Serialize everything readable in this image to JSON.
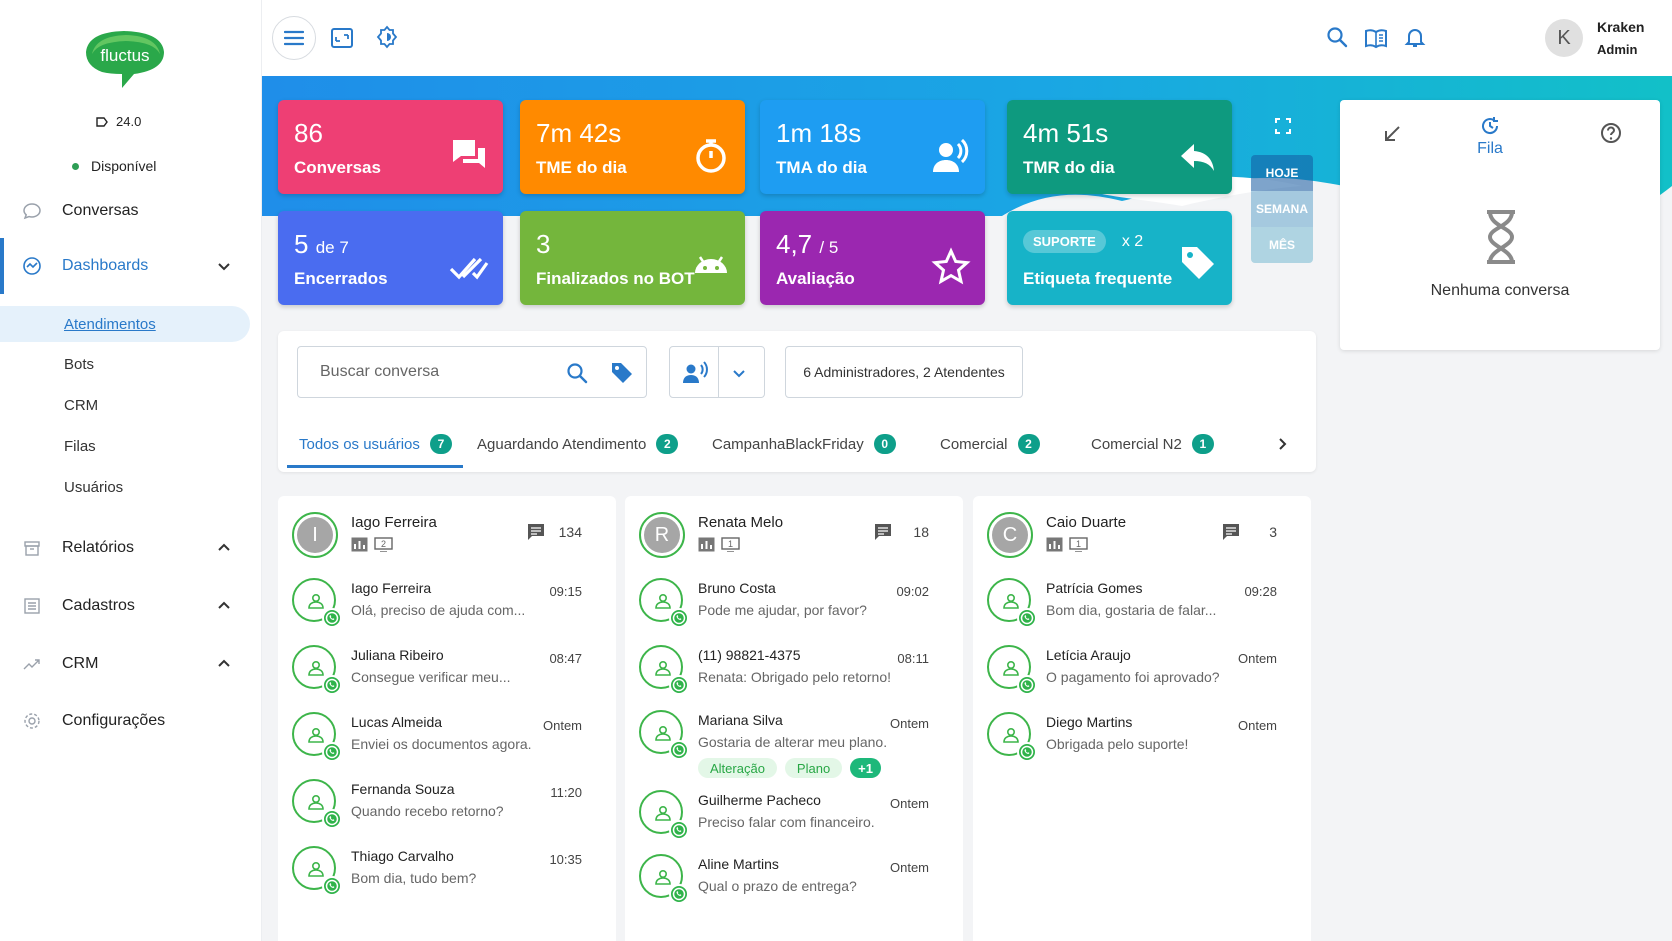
{
  "brand": {
    "logo_text": "fluctus",
    "version": "24.0",
    "status": "Disponível",
    "status_color": "#2e9e55"
  },
  "sidebar": {
    "items": [
      {
        "label": "Conversas",
        "icon": "chat-bubble-icon"
      },
      {
        "label": "Dashboards",
        "icon": "dashboard-gauge-icon"
      },
      {
        "label": "Relatórios",
        "icon": "archive-box-icon"
      },
      {
        "label": "Cadastros",
        "icon": "list-icon"
      },
      {
        "label": "CRM",
        "icon": "trend-chart-icon"
      },
      {
        "label": "Configurações",
        "icon": "gear-icon"
      }
    ],
    "dashboard_sub": [
      "Atendimentos",
      "Bots",
      "CRM",
      "Filas",
      "Usuários"
    ]
  },
  "topbar": {
    "user_initial": "K",
    "user_name": "Kraken",
    "user_role": "Admin"
  },
  "stats": {
    "conversas": {
      "value": "86",
      "label": "Conversas",
      "color": "#ee3f74"
    },
    "tme": {
      "value": "7m 42s",
      "label": "TME do dia",
      "color": "#ff8a00"
    },
    "tma": {
      "value": "1m 18s",
      "label": "TMA do dia",
      "color": "#1e9df2"
    },
    "tmr": {
      "value": "4m 51s",
      "label": "TMR do dia",
      "color": "#0e9a7f"
    },
    "encerrados": {
      "value": "5",
      "of": "de 7",
      "label": "Encerrados",
      "color": "#4a6cf0"
    },
    "bot": {
      "value": "3",
      "label": "Finalizados no BOT",
      "color": "#74b63c"
    },
    "avaliacao": {
      "value": "4,7",
      "of": "/ 5",
      "label": "Avaliação",
      "color": "#9b27b0"
    },
    "etiqueta": {
      "tag": "SUPORTE",
      "mult": "x 2",
      "label": "Etiqueta frequente",
      "color": "#17b3c8"
    }
  },
  "period": {
    "options": [
      "HOJE",
      "SEMANA",
      "MÊS"
    ],
    "selected": "HOJE"
  },
  "queue_panel": {
    "tab_label": "Fila",
    "empty_text": "Nenhuma conversa"
  },
  "filters": {
    "search_placeholder": "Buscar conversa",
    "agents_summary": "6 Administradores, 2 Atendentes",
    "tabs": [
      {
        "label": "Todos os usuários",
        "count": "7"
      },
      {
        "label": "Aguardando Atendimento",
        "count": "2"
      },
      {
        "label": "CampanhaBlackFriday",
        "count": "0"
      },
      {
        "label": "Comercial",
        "count": "2"
      },
      {
        "label": "Comercial N2",
        "count": "1"
      }
    ]
  },
  "columns": [
    {
      "agent": {
        "initial": "I",
        "name": "Iago Ferreira",
        "queue_badge": "2",
        "count": "134"
      },
      "conversations": [
        {
          "name": "Iago Ferreira",
          "message": "Olá, preciso de ajuda com...",
          "time": "09:15"
        },
        {
          "name": "Juliana Ribeiro",
          "message": "Consegue verificar meu...",
          "time": "08:47"
        },
        {
          "name": "Lucas Almeida",
          "message": "Enviei os documentos agora.",
          "time": "Ontem"
        },
        {
          "name": "Fernanda Souza",
          "message": "Quando recebo retorno?",
          "time": "11:20"
        },
        {
          "name": "Thiago Carvalho",
          "message": "Bom dia, tudo bem?",
          "time": "10:35"
        }
      ]
    },
    {
      "agent": {
        "initial": "R",
        "name": "Renata Melo",
        "queue_badge": "1",
        "count": "18"
      },
      "conversations": [
        {
          "name": "Bruno Costa",
          "message": "Pode me ajudar, por favor?",
          "time": "09:02"
        },
        {
          "name": "(11) 98821-4375",
          "message": "Renata: Obrigado pelo retorno!",
          "time": "08:11"
        },
        {
          "name": "Mariana Silva",
          "message": "Gostaria de alterar meu plano.",
          "time": "Ontem",
          "tags": [
            "Alteração",
            "Plano"
          ],
          "more": "+1"
        },
        {
          "name": "Guilherme Pacheco",
          "message": "Preciso falar com financeiro.",
          "time": "Ontem"
        },
        {
          "name": "Aline Martins",
          "message": "Qual o prazo de entrega?",
          "time": "Ontem"
        }
      ]
    },
    {
      "agent": {
        "initial": "C",
        "name": "Caio Duarte",
        "queue_badge": "1",
        "count": "3"
      },
      "conversations": [
        {
          "name": "Patrícia Gomes",
          "message": "Bom dia, gostaria de falar...",
          "time": "09:28"
        },
        {
          "name": "Letícia Araujo",
          "message": "O pagamento foi aprovado?",
          "time": "Ontem"
        },
        {
          "name": "Diego Martins",
          "message": "Obrigada pelo suporte!",
          "time": "Ontem"
        }
      ]
    }
  ]
}
